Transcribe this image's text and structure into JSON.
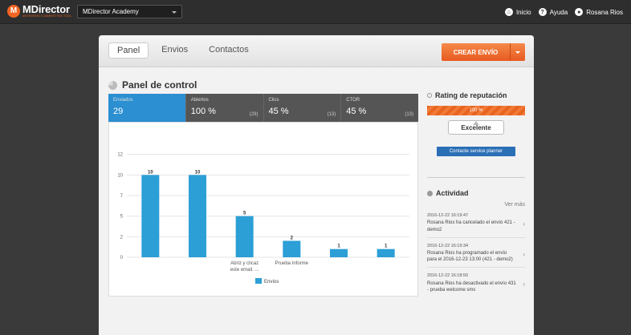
{
  "brand": {
    "name": "MDirector",
    "tagline": "ANTEVENIO E-MARKETING TOOL"
  },
  "account_selector": {
    "value": "MDirector Academy"
  },
  "top_nav": [
    {
      "label": "Inicio",
      "icon": "home-icon"
    },
    {
      "label": "Ayuda",
      "icon": "help-icon"
    },
    {
      "label": "Rosana Rios",
      "icon": "user-icon"
    }
  ],
  "tabs": [
    "Panel",
    "Envios",
    "Contactos"
  ],
  "create_button": {
    "label": "CREAR ENVÍO"
  },
  "panel": {
    "title": "Panel de control"
  },
  "stats": [
    {
      "label": "Enviados",
      "value": "29",
      "sub": ""
    },
    {
      "label": "Abiertos",
      "value": "100 %",
      "sub": "(29)"
    },
    {
      "label": "Clics",
      "value": "45 %",
      "sub": "(13)"
    },
    {
      "label": "CTOR",
      "value": "45 %",
      "sub": "(13)"
    }
  ],
  "chart_data": {
    "type": "bar",
    "categories": [
      "",
      "",
      "Abriz y clicaz este email. ...",
      "Prueba Informe",
      "",
      ""
    ],
    "values": [
      10,
      10,
      5,
      2,
      1,
      1
    ],
    "series": [
      {
        "name": "Envíos",
        "values": [
          10,
          10,
          5,
          2,
          1,
          1
        ]
      }
    ],
    "ylim": [
      0,
      15
    ],
    "yticks": [
      0,
      2.5,
      5,
      7.5,
      10,
      12.5
    ],
    "ytick_labels": [
      "0",
      "2",
      "5",
      "7",
      "10",
      "12"
    ],
    "legend_position": "bottom",
    "grid": true,
    "color": "#2b9fd6"
  },
  "rating": {
    "title": "Rating de reputación",
    "percent_label": "100 %",
    "level": "Excelente",
    "planner_button": "Contacte service planner"
  },
  "activity": {
    "title": "Actividad",
    "see_more": "Ver más",
    "items": [
      {
        "time": "2016-12-22 16:19:47",
        "text": "Rosana Rios ha cancelado el envío 421 - demo2"
      },
      {
        "time": "2016-12-22 16:19:34",
        "text": "Rosana Rios ha programado el envío para el 2016-12-23 13:00 (421 - demo2)"
      },
      {
        "time": "2016-12-22 16:18:50",
        "text": "Rosana Rios ha desactivado el envío 431 - prueba welcome sms"
      }
    ]
  }
}
